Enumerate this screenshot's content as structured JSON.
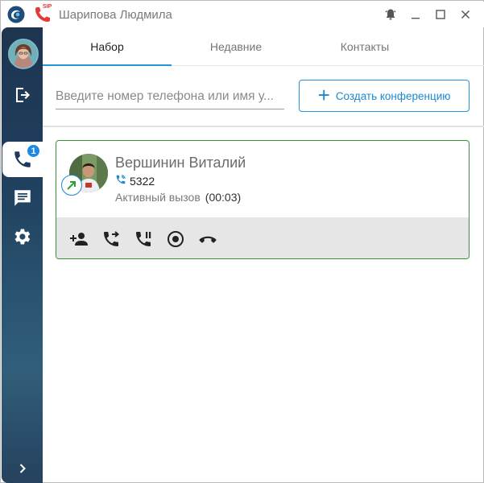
{
  "window": {
    "title": "Шарипова Людмила",
    "sip_badge": "SIP",
    "controls": [
      "bell-icon",
      "minimize-icon",
      "maximize-icon",
      "close-icon"
    ]
  },
  "sidebar": {
    "call_badge_count": "1",
    "items": [
      "avatar",
      "logout-icon",
      "phone-icon",
      "chat-icon",
      "settings-icon",
      "expand-icon"
    ]
  },
  "tabs": [
    {
      "label": "Набор",
      "active": true
    },
    {
      "label": "Недавние",
      "active": false
    },
    {
      "label": "Контакты",
      "active": false
    }
  ],
  "search": {
    "placeholder": "Введите номер телефона или имя у...",
    "value": ""
  },
  "conference_button": {
    "label": "Создать конференцию"
  },
  "call": {
    "name": "Вершинин Виталий",
    "number": "5322",
    "status": "Активный вызов",
    "duration": "(00:03)",
    "actions": [
      "add-participant-icon",
      "transfer-icon",
      "hold-icon",
      "record-icon",
      "hangup-icon"
    ]
  },
  "colors": {
    "accent": "#2196d9",
    "card_border": "#3a8f3a",
    "sidebar": "#1e3450",
    "hangup": "#222222",
    "sip_red": "#e53935"
  }
}
